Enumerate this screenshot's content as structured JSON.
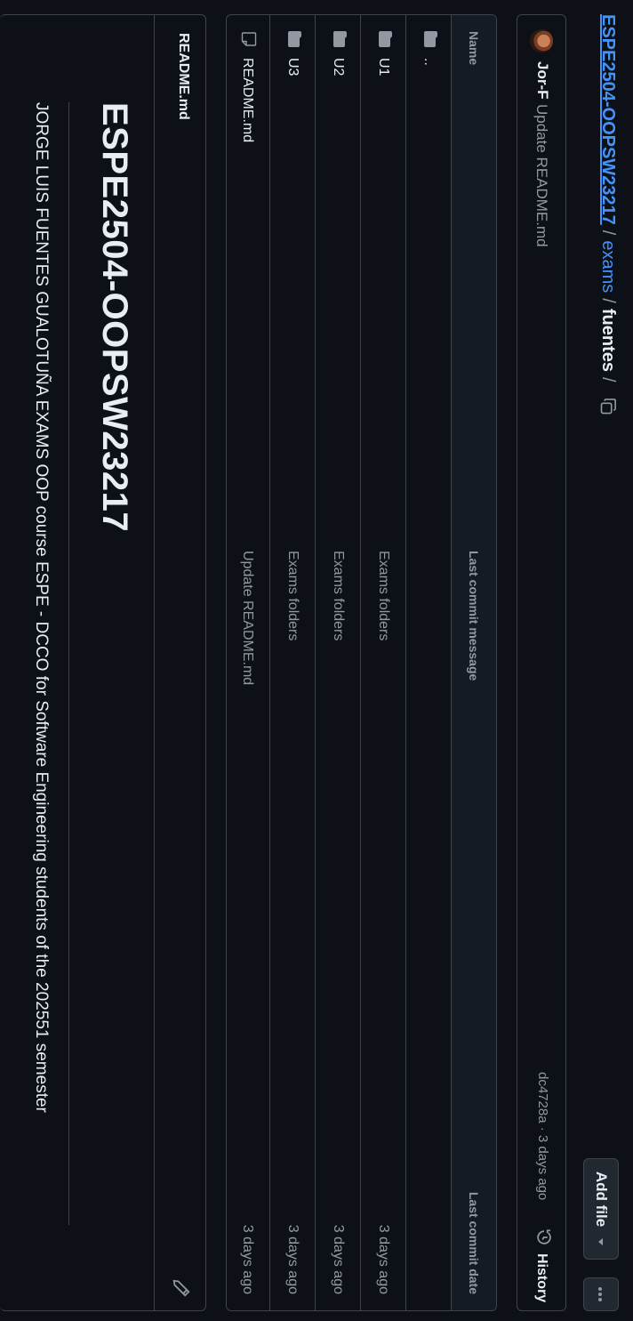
{
  "breadcrumb": {
    "repo": "ESPE2504-OOPSW23217",
    "folder": "exams",
    "current": "fuentes",
    "sep": "/"
  },
  "actions": {
    "add_file_label": "Add file",
    "history_label": "History"
  },
  "commit": {
    "author": "Jor-F",
    "message": "Update README.md",
    "meta": "dc4728a · 3 days ago"
  },
  "table": {
    "headers": {
      "name": "Name",
      "message": "Last commit message",
      "date": "Last commit date"
    },
    "parent_label": "..",
    "rows": [
      {
        "name": "U1",
        "message": "Exams folders",
        "date": "3 days ago",
        "icon": "folder-icon"
      },
      {
        "name": "U2",
        "message": "Exams folders",
        "date": "3 days ago",
        "icon": "folder-icon"
      },
      {
        "name": "U3",
        "message": "Exams folders",
        "date": "3 days ago",
        "icon": "folder-icon"
      },
      {
        "name": "README.md",
        "message": "Update README.md",
        "date": "3 days ago",
        "icon": "file-icon"
      }
    ]
  },
  "readme": {
    "tab_label": "README.md",
    "title": "ESPE2504-OOPSW23217",
    "body": "JORGE LUIS FUENTES GUALOTUÑA EXAMS OOP course ESPE - DCCO for Software Engineering students of the 202551 semester"
  },
  "colors": {
    "background": "#0d1117",
    "border": "#3d444d",
    "link": "#4493f8",
    "muted": "#9198a1",
    "text": "#e6edf3"
  }
}
